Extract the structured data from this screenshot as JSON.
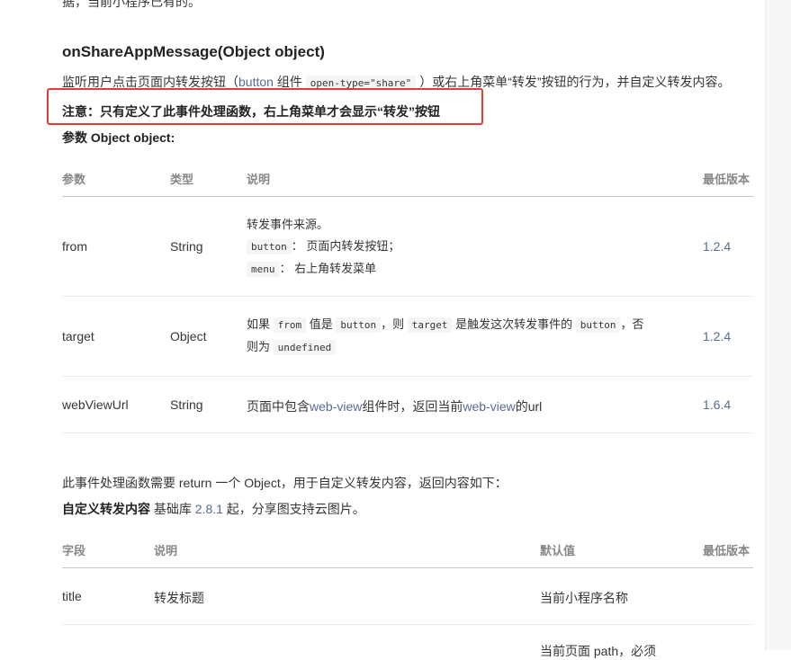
{
  "top_cut_text": "据，当前小程序已有的。",
  "section_title": "onShareAppMessage(Object object)",
  "description": {
    "part1": "监听用户点击页面内转发按钮（",
    "button_link": "button",
    "part2": " 组件 ",
    "code": "open-type=\"share\"",
    "part3": " ）或右上角菜单“转发”按钮的行为，并自定义转发内容。"
  },
  "note": "注意：只有定义了此事件处理函数，右上角菜单才会显示“转发”按钮",
  "params_title": "参数 Object object:",
  "params_table": {
    "headers": [
      "参数",
      "类型",
      "说明",
      "最低版本"
    ],
    "rows": [
      {
        "name": "from",
        "type": "String",
        "desc_line1": "转发事件来源。",
        "desc_code1": "button",
        "desc_text1": "： 页面内转发按钮；",
        "desc_code2": "menu",
        "desc_text2": "： 右上角转发菜单",
        "version": "1.2.4"
      },
      {
        "name": "target",
        "type": "Object",
        "desc_t1": "如果 ",
        "desc_c1": "from",
        "desc_t2": " 值是 ",
        "desc_c2": "button",
        "desc_t3": "，则 ",
        "desc_c3": "target",
        "desc_t4": " 是触发这次转发事件的 ",
        "desc_c4": "button",
        "desc_t5": "，否",
        "desc_t6": "则为 ",
        "desc_c5": "undefined",
        "version": "1.2.4"
      },
      {
        "name": "webViewUrl",
        "type": "String",
        "desc_t1": "页面中包含",
        "desc_l1": "web-view",
        "desc_t2": "组件时，返回当前",
        "desc_l2": "web-view",
        "desc_t3": "的url",
        "version": "1.6.4"
      }
    ]
  },
  "return_paragraph": "此事件处理函数需要 return 一个 Object，用于自定义转发内容，返回内容如下：",
  "custom_line": {
    "bold": "自定义转发内容",
    "t1": " 基础库 ",
    "version_link": "2.8.1",
    "t2": " 起，分享图支持云图片。"
  },
  "fields_table": {
    "headers": [
      "字段",
      "说明",
      "默认值",
      "最低版本"
    ],
    "rows": [
      {
        "name": "title",
        "desc": "转发标题",
        "default": "当前小程序名称",
        "version": ""
      }
    ],
    "cut_row_default": "当前页面 path，必须"
  }
}
